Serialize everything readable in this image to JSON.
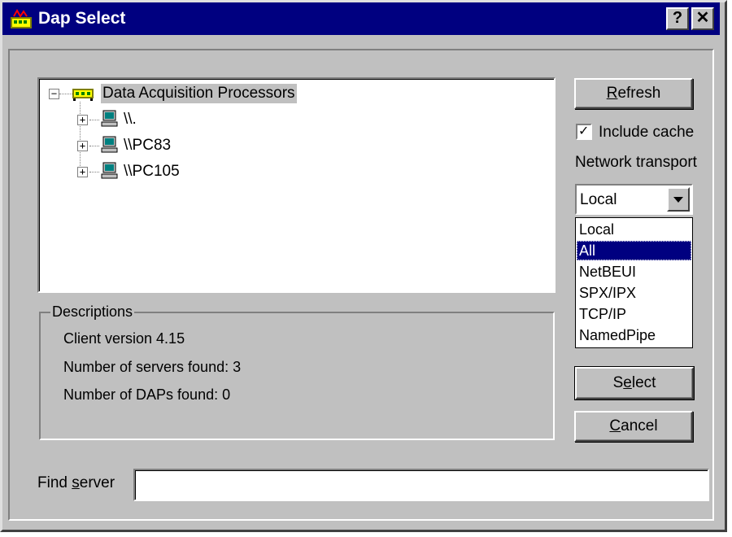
{
  "window": {
    "title": "Dap Select",
    "help_button": "?",
    "close_button": "✕"
  },
  "tree": {
    "root": "Data Acquisition Processors",
    "root_expander": "−",
    "children": [
      {
        "label": "\\\\.",
        "expander": "+"
      },
      {
        "label": "\\\\PC83",
        "expander": "+"
      },
      {
        "label": "\\\\PC105",
        "expander": "+"
      }
    ]
  },
  "descriptions": {
    "title": "Descriptions",
    "lines": [
      "Client version 4.15",
      "Number of servers found: 3",
      "Number of DAPs found: 0"
    ]
  },
  "buttons": {
    "refresh": {
      "pre": "",
      "key": "R",
      "post": "efresh"
    },
    "select": {
      "pre": "S",
      "key": "e",
      "post": "lect"
    },
    "cancel": {
      "pre": "",
      "key": "C",
      "post": "ancel"
    }
  },
  "include_cache": {
    "label": "Include cache",
    "checked": true,
    "check_glyph": "✓"
  },
  "network_transport": {
    "label": "Network transport",
    "value": "Local",
    "options": [
      "Local",
      "All",
      "NetBEUI",
      "SPX/IPX",
      "TCP/IP",
      "NamedPipe"
    ],
    "highlighted": "All"
  },
  "find_server": {
    "pre": "Find ",
    "key": "s",
    "post": "erver",
    "value": ""
  },
  "colors": {
    "titlebar": "#000080",
    "face": "#c0c0c0",
    "selection": "#000080"
  }
}
